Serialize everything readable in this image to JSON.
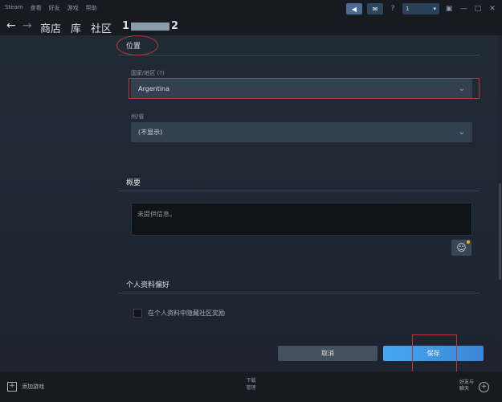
{
  "titlebar": {
    "menu": [
      "Steam",
      "查看",
      "好友",
      "游戏",
      "帮助"
    ],
    "user_label": "1",
    "icons": [
      "megaphone-icon",
      "mail-icon",
      "help-icon",
      "user-dropdown",
      "screenshot-icon",
      "minimize-icon",
      "maximize-icon",
      "close-icon"
    ],
    "help_glyph": "?"
  },
  "nav": {
    "links": [
      "商店",
      "库",
      "社区"
    ],
    "user_prefix": "1",
    "user_suffix": "2"
  },
  "location": {
    "title": "位置",
    "country_label": "国家/地区 (?)",
    "country_value": "Argentina",
    "state_label": "州/省",
    "state_value": "(不显示)"
  },
  "summary": {
    "title": "概要",
    "text": "未提供信息。"
  },
  "preferences": {
    "title": "个人资料偏好",
    "hide_awards_label": "在个人资料中隐藏社区奖励"
  },
  "actions": {
    "cancel": "取消",
    "save": "保存"
  },
  "bottombar": {
    "add_game": "添加游戏",
    "downloads_line1": "下载",
    "downloads_line2": "管理",
    "friends_line1": "好友与",
    "friends_line2": "聊天"
  },
  "colors": {
    "background": "#1b2838",
    "accent_blue": "#47a6f0",
    "annotation_red": "#c03434"
  }
}
